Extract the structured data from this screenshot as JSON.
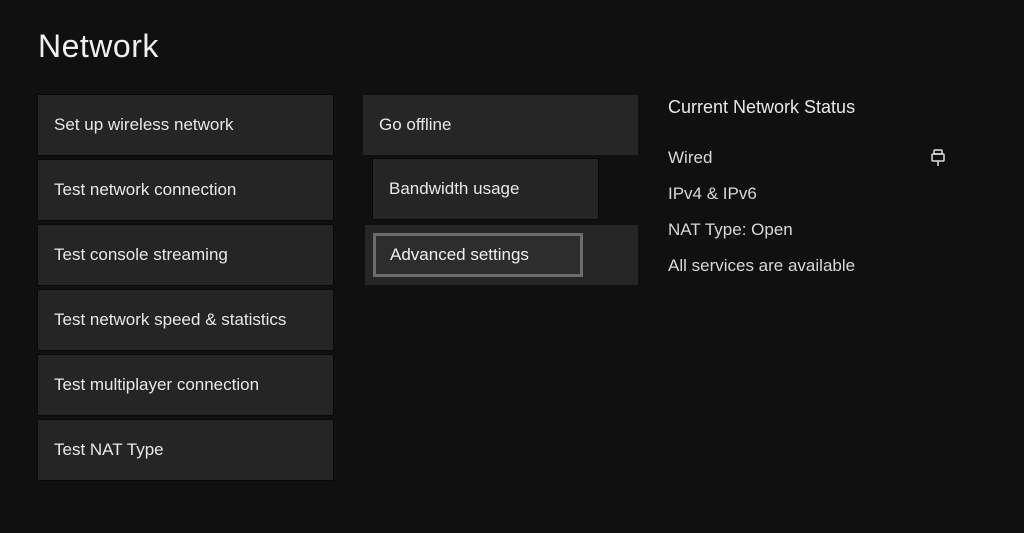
{
  "title": "Network",
  "left_column": [
    "Set up wireless network",
    "Test network connection",
    "Test console streaming",
    "Test network speed & statistics",
    "Test multiplayer connection",
    "Test NAT Type"
  ],
  "mid_column": {
    "go_offline": "Go offline",
    "bandwidth_usage": "Bandwidth usage",
    "advanced_settings": "Advanced settings"
  },
  "status": {
    "heading": "Current Network Status",
    "connection": "Wired",
    "ip": "IPv4 & IPv6",
    "nat": "NAT Type: Open",
    "services": "All services are available"
  }
}
